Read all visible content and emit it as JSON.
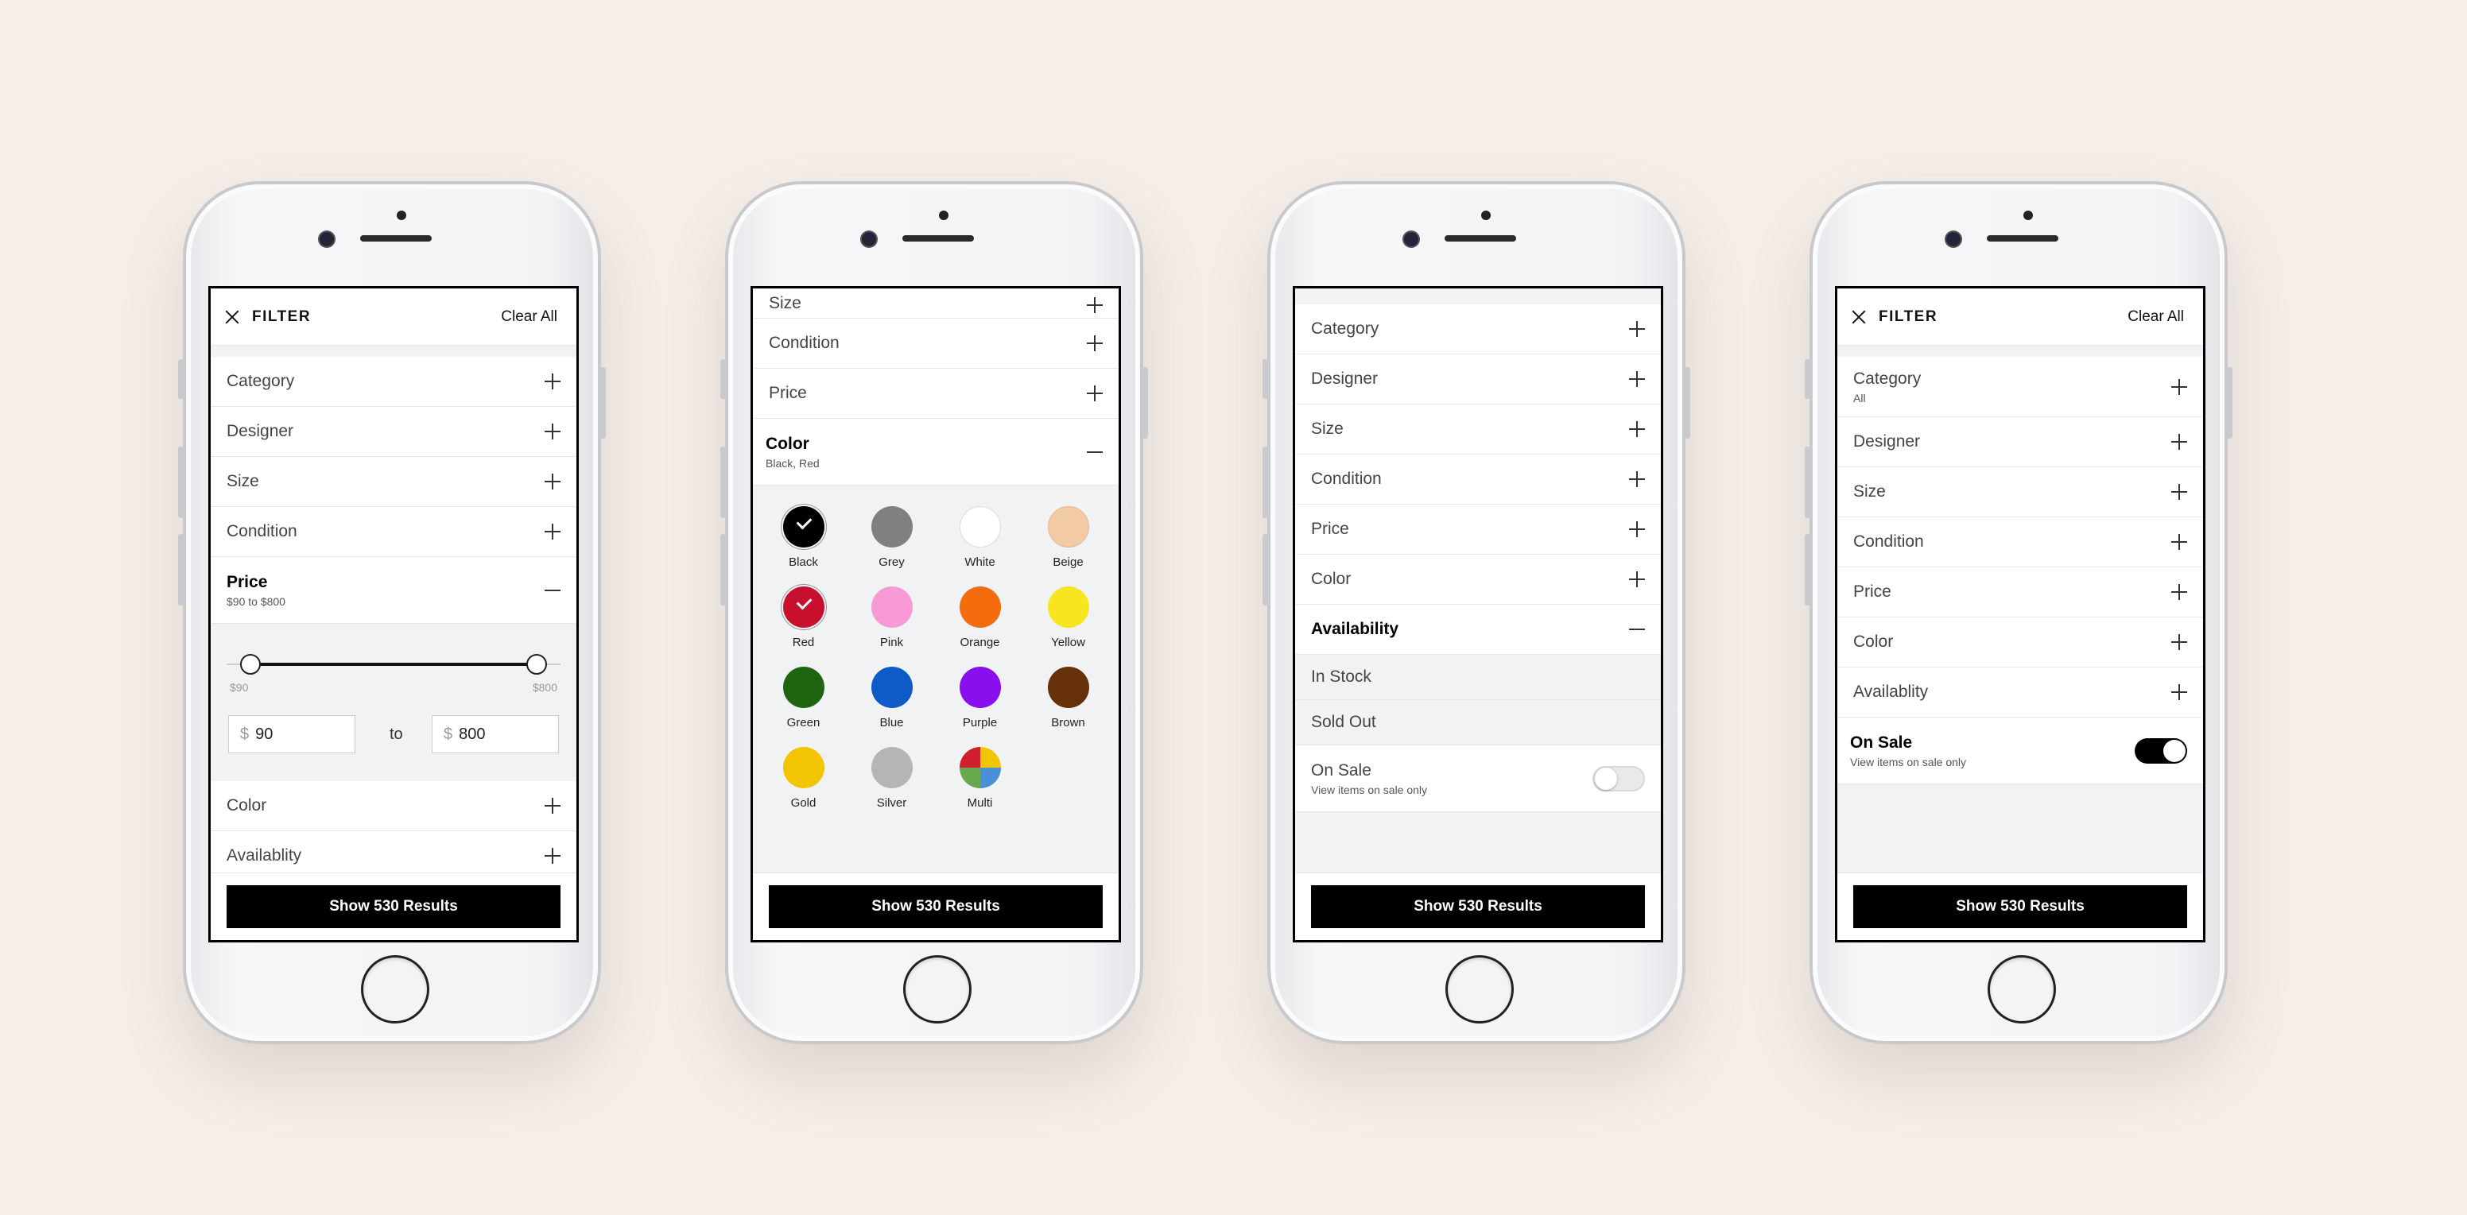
{
  "common": {
    "filter_title": "FILTER",
    "clear_all": "Clear All",
    "show_results": "Show 530 Results"
  },
  "phone1": {
    "items": [
      {
        "label": "Category"
      },
      {
        "label": "Designer"
      },
      {
        "label": "Size"
      },
      {
        "label": "Condition"
      }
    ],
    "price": {
      "label": "Price",
      "summary": "$90 to $800",
      "min_label": "$90",
      "max_label": "$800",
      "currency": "$",
      "min_value": "90",
      "max_value": "800",
      "to_label": "to",
      "range_min": 90,
      "range_max": 800,
      "selected_min": 90,
      "selected_max": 800
    },
    "after_items": [
      {
        "label": "Color"
      },
      {
        "label": "Availablity"
      }
    ]
  },
  "phone2": {
    "items": [
      {
        "label": "Size"
      },
      {
        "label": "Condition"
      },
      {
        "label": "Price"
      }
    ],
    "color": {
      "label": "Color",
      "summary": "Black, Red"
    },
    "swatches": [
      {
        "name": "Black",
        "color": "#000000",
        "selected": true
      },
      {
        "name": "Grey",
        "color": "#808080",
        "selected": false
      },
      {
        "name": "White",
        "color": "#ffffff",
        "selected": false
      },
      {
        "name": "Beige",
        "color": "#f2cba5",
        "selected": false
      },
      {
        "name": "Red",
        "color": "#c8102e",
        "selected": true
      },
      {
        "name": "Pink",
        "color": "#f79ad5",
        "selected": false
      },
      {
        "name": "Orange",
        "color": "#f36c0e",
        "selected": false
      },
      {
        "name": "Yellow",
        "color": "#f6e51f",
        "selected": false
      },
      {
        "name": "Green",
        "color": "#1f6410",
        "selected": false
      },
      {
        "name": "Blue",
        "color": "#0e5bc7",
        "selected": false
      },
      {
        "name": "Purple",
        "color": "#8a0fef",
        "selected": false
      },
      {
        "name": "Brown",
        "color": "#66300a",
        "selected": false
      },
      {
        "name": "Gold",
        "color": "#f3c402",
        "selected": false
      },
      {
        "name": "Silver",
        "color": "#b5b5b3",
        "selected": false
      },
      {
        "name": "Multi",
        "color": "multi",
        "selected": false
      }
    ]
  },
  "phone3": {
    "items": [
      {
        "label": "Category"
      },
      {
        "label": "Designer"
      },
      {
        "label": "Size"
      },
      {
        "label": "Condition"
      },
      {
        "label": "Price"
      },
      {
        "label": "Color"
      }
    ],
    "availability": {
      "label": "Availability",
      "options": [
        "In Stock",
        "Sold Out"
      ]
    },
    "on_sale": {
      "label": "On Sale",
      "sub": "View items on sale only",
      "enabled": false
    }
  },
  "phone4": {
    "category": {
      "label": "Category",
      "summary": "All"
    },
    "items": [
      {
        "label": "Designer"
      },
      {
        "label": "Size"
      },
      {
        "label": "Condition"
      },
      {
        "label": "Price"
      },
      {
        "label": "Color"
      },
      {
        "label": "Availablity"
      }
    ],
    "on_sale": {
      "label": "On Sale",
      "sub": "View items on sale only",
      "enabled": true
    }
  }
}
